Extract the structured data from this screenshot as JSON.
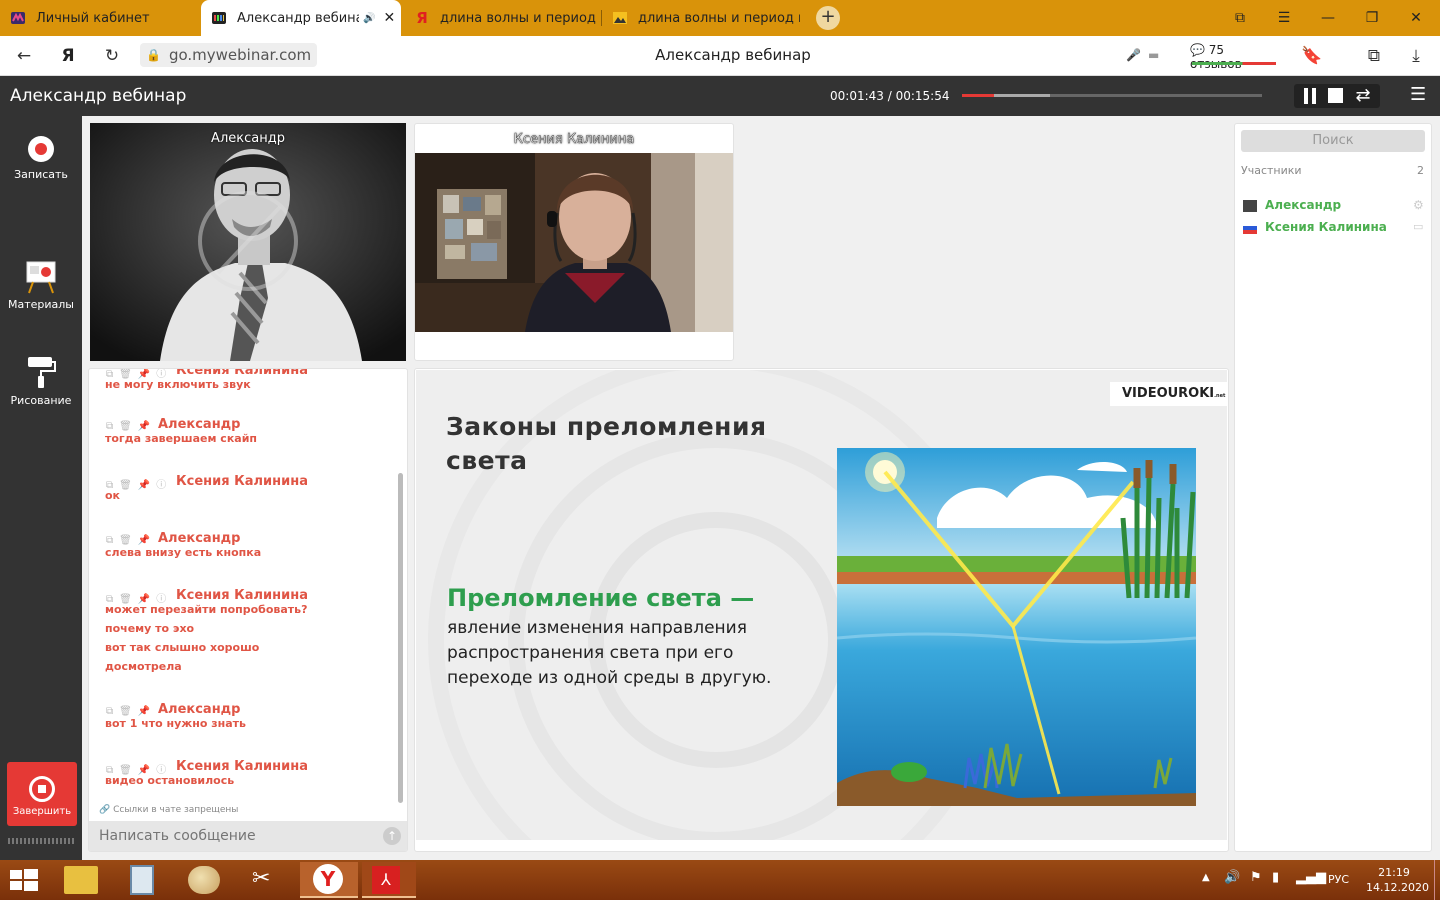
{
  "browser": {
    "tabs": [
      {
        "label": "Личный кабинет",
        "active": false
      },
      {
        "label": "Александр вебинар",
        "active": true
      },
      {
        "label": "длина волны и период и с",
        "active": false
      },
      {
        "label": "длина волны и период и с",
        "active": false
      }
    ],
    "url": "go.mywebinar.com",
    "page_title": "Александр вебинар",
    "reviews": "75 отзывов"
  },
  "webinar": {
    "title": "Александр вебинар",
    "time": "00:01:43 / 00:15:54",
    "progress_fraction": 0.108
  },
  "sidebar": {
    "record_label": "Записать",
    "materials_label": "Материалы",
    "drawing_label": "Рисование",
    "finish_label": "Завершить"
  },
  "videos": {
    "presenter_name": "Александр",
    "guest_name": "Ксения Калинина"
  },
  "chat": {
    "messages": [
      {
        "author": "Ксения Калинина",
        "lines": [
          "не могу включить звук"
        ],
        "guest": true
      },
      {
        "author": "Александр",
        "lines": [
          "тогда завершаем скайп"
        ],
        "guest": false
      },
      {
        "author": "Ксения Калинина",
        "lines": [
          "ок"
        ],
        "guest": true
      },
      {
        "author": "Александр",
        "lines": [
          "слева внизу есть кнопка"
        ],
        "guest": false
      },
      {
        "author": "Ксения Калинина",
        "lines": [
          "может перезайти попробовать?",
          "почему то эхо",
          "вот так слышно хорошо",
          "досмотрела"
        ],
        "guest": true
      },
      {
        "author": "Александр",
        "lines": [
          "вот 1 что нужно знать"
        ],
        "guest": false
      },
      {
        "author": "Ксения Калинина",
        "lines": [
          "видео остановилось"
        ],
        "guest": true
      }
    ],
    "links_notice": "Ссылки в чате запрещены",
    "input_placeholder": "Написать сообщение"
  },
  "slide": {
    "brand": "VIDEOUROKI",
    "brand_suffix": ".net",
    "title_line1": "Законы преломления",
    "title_line2": "света",
    "term": "Преломление света —",
    "def_line1": "явление изменения направления",
    "def_line2": "распространения света при его",
    "def_line3": "переходе из одной среды в другую."
  },
  "participants": {
    "search_label": "Поиск",
    "header": "Участники",
    "count": "2",
    "list": [
      {
        "name": "Александр"
      },
      {
        "name": "Ксения Калинина"
      }
    ]
  },
  "taskbar": {
    "lang": "РУС",
    "time": "21:19",
    "date": "14.12.2020"
  },
  "colors": {
    "tabbar": "#d9930a",
    "header": "#333333",
    "accent_red": "#e53935",
    "chat_text": "#e05545",
    "participant_green": "#4caf50",
    "taskbar": "#8a3b0e"
  }
}
